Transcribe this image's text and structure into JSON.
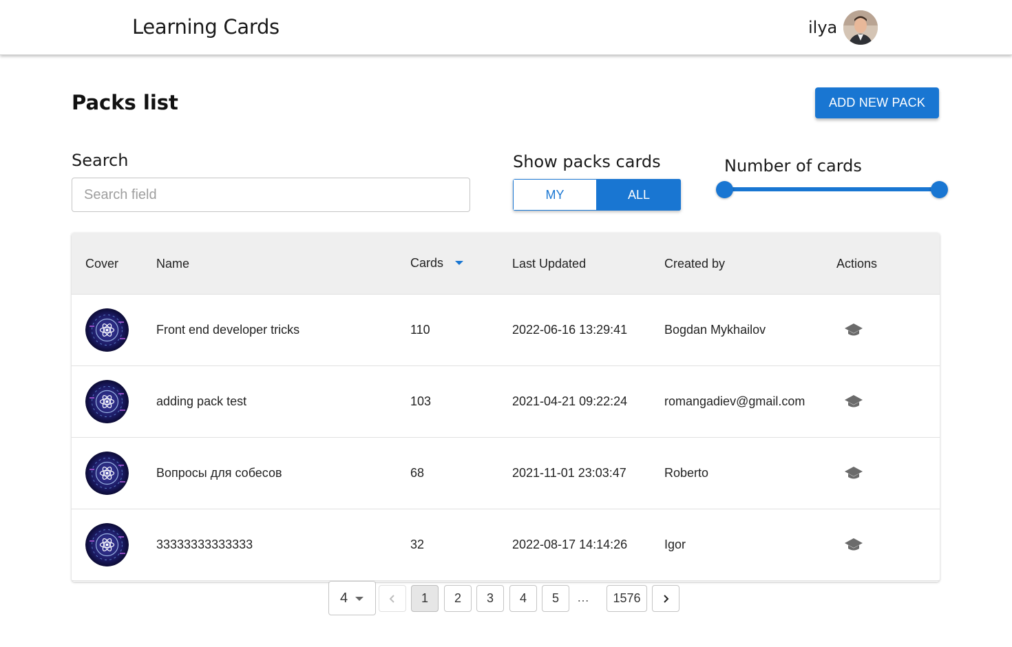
{
  "header": {
    "app_title": "Learning Cards",
    "user_name": "ilya"
  },
  "page": {
    "title": "Packs list",
    "add_button": "ADD NEW PACK"
  },
  "filters": {
    "search_label": "Search",
    "search_placeholder": "Search field",
    "search_value": "",
    "show_label": "Show packs cards",
    "toggle_my": "MY",
    "toggle_all": "ALL",
    "toggle_selected": "ALL",
    "number_label": "Number of cards"
  },
  "table": {
    "columns": [
      "Cover",
      "Name",
      "Cards",
      "Last Updated",
      "Created by",
      "Actions"
    ],
    "sort_column": "Cards",
    "rows": [
      {
        "name": "Front end developer tricks",
        "cards": "110",
        "updated": "2022-06-16 13:29:41",
        "created_by": "Bogdan Mykhailov",
        "action_icon": "graduation-cap-icon"
      },
      {
        "name": "adding pack test",
        "cards": "103",
        "updated": "2021-04-21 09:22:24",
        "created_by": "romangadiev@gmail.com",
        "action_icon": "graduation-cap-icon"
      },
      {
        "name": "Вопросы для собесов",
        "cards": "68",
        "updated": "2021-11-01 23:03:47",
        "created_by": "Roberto",
        "action_icon": "graduation-cap-icon"
      },
      {
        "name": "33333333333333",
        "cards": "32",
        "updated": "2022-08-17 14:14:26",
        "created_by": "Igor",
        "action_icon": "graduation-cap-icon"
      }
    ]
  },
  "pagination": {
    "per_page": "4",
    "pages": [
      "1",
      "2",
      "3",
      "4",
      "5"
    ],
    "current": "1",
    "ellipsis": "…",
    "last_page": "1576"
  },
  "colors": {
    "primary": "#1976d2",
    "header_bg": "#efefef"
  }
}
